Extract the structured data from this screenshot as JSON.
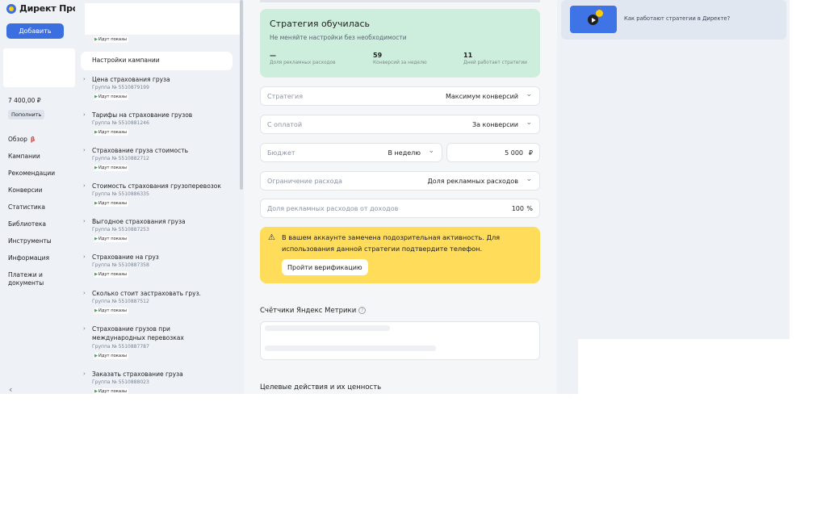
{
  "nav": {
    "logo_text": "Директ Про",
    "add_button": "Добавить",
    "balance": "7 400,00 ₽",
    "topup_button": "Пополнить",
    "items": [
      {
        "label": "Обзор",
        "beta": "β"
      },
      {
        "label": "Кампании"
      },
      {
        "label": "Рекомендации"
      },
      {
        "label": "Конверсии"
      },
      {
        "label": "Статистика"
      },
      {
        "label": "Библиотека"
      },
      {
        "label": "Инструменты"
      },
      {
        "label": "Информация"
      },
      {
        "label": "Платежи и документы"
      }
    ],
    "collapse_icon": "‹"
  },
  "tree": {
    "top_badge": "Идут показы",
    "settings_item": "Настройки кампании",
    "groups": [
      {
        "name": "Цена страхования груза",
        "number": "Группа № 5510879199",
        "status": "Идут показы"
      },
      {
        "name": "Тарифы на страхование грузов",
        "number": "Группа № 5510881246",
        "status": "Идут показы"
      },
      {
        "name": "Страхование груза стоимость",
        "number": "Группа № 5510882712",
        "status": "Идут показы"
      },
      {
        "name": "Стоимость страхования грузоперевозок",
        "number": "Группа № 5510886335",
        "status": "Идут показы"
      },
      {
        "name": "Выгодное страхования груза",
        "number": "Группа № 5510887253",
        "status": "Идут показы"
      },
      {
        "name": "Страхование на груз",
        "number": "Группа № 5510887358",
        "status": "Идут показы"
      },
      {
        "name": "Сколько стоит застраховать груз.",
        "number": "Группа № 5510887512",
        "status": "Идут показы"
      },
      {
        "name": "Страхование грузов при международных перевозках",
        "number": "Группа № 5510887787",
        "status": "Идут показы"
      },
      {
        "name": "Заказать страхование груза",
        "number": "Группа № 5510888023",
        "status": "Идут показы"
      }
    ]
  },
  "strategy": {
    "learned_title": "Стратегия обучилась",
    "learned_subtitle": "Не меняйте настройки без необходимости",
    "stats": [
      {
        "value": "—",
        "label": "Доля рекламных расходов"
      },
      {
        "value": "59",
        "label": "Конверсий за неделю"
      },
      {
        "value": "11",
        "label": "Дней работает стратегии"
      }
    ],
    "fields": {
      "strategy": {
        "label": "Стратегия",
        "value": "Максимум конверсий"
      },
      "payment": {
        "label": "С оплатой",
        "value": "За конверсии"
      },
      "budget": {
        "label": "Бюджет",
        "value": "В неделю",
        "amount": "5 000",
        "currency": "₽"
      },
      "limit": {
        "label": "Ограничение расхода",
        "value": "Доля рекламных расходов"
      },
      "share": {
        "label": "Доля рекламных расходов от доходов",
        "value": "100",
        "unit": "%"
      }
    },
    "warning": {
      "text": "В вашем аккаунте замечена подозрительная активность. Для использования данной стратегии подтвердите телефон.",
      "button": "Пройти верификацию"
    },
    "metrika_title": "Счётчики Яндекс Метрики",
    "goals_title": "Целевые действия и их ценность"
  },
  "right": {
    "video_title": "Как работают стратегии в Директе?"
  }
}
